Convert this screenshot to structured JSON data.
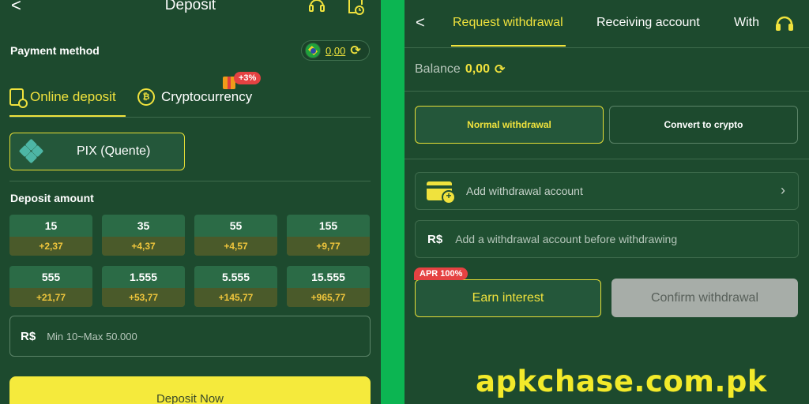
{
  "deposit": {
    "title": "Deposit",
    "back_glyph": "<",
    "support_icon": "headset-icon",
    "history_icon": "document-clock-icon",
    "payment_method_label": "Payment method",
    "balance": "0,00",
    "tabs": [
      {
        "label": "Online deposit",
        "icon": "phone-icon",
        "active": true
      },
      {
        "label": "Cryptocurrency",
        "icon": "coin-icon",
        "active": false,
        "badge": "+3%"
      }
    ],
    "method": {
      "label": "PIX (Quente)",
      "icon": "pix-logo"
    },
    "amount_label": "Deposit amount",
    "amounts": [
      {
        "value": "15",
        "bonus": "+2,37"
      },
      {
        "value": "35",
        "bonus": "+4,37"
      },
      {
        "value": "55",
        "bonus": "+4,57"
      },
      {
        "value": "155",
        "bonus": "+9,77"
      },
      {
        "value": "555",
        "bonus": "+21,77"
      },
      {
        "value": "1.555",
        "bonus": "+53,77"
      },
      {
        "value": "5.555",
        "bonus": "+145,77"
      },
      {
        "value": "15.555",
        "bonus": "+965,77"
      }
    ],
    "currency": "R$",
    "amount_placeholder": "Min 10~Max 50.000",
    "submit_label": "Deposit Now"
  },
  "withdraw": {
    "back_glyph": "<",
    "tabs": [
      {
        "label": "Request withdrawal",
        "active": true
      },
      {
        "label": "Receiving account",
        "active": false
      },
      {
        "label": "With",
        "active": false
      }
    ],
    "balance_label": "Balance",
    "balance_value": "0,00",
    "types": [
      {
        "label": "Normal withdrawal",
        "selected": true
      },
      {
        "label": "Convert to crypto",
        "selected": false
      }
    ],
    "add_account_label": "Add withdrawal account",
    "currency": "R$",
    "input_placeholder": "Add a withdrawal account before withdrawing",
    "apr_badge": "APR 100%",
    "earn_label": "Earn interest",
    "confirm_label": "Confirm withdrawal"
  },
  "watermark": "apkchase.com.pk",
  "colors": {
    "panel_bg": "#1d4a2e",
    "accent_yellow": "#f0e23d",
    "divider_green": "#0cb552",
    "bonus_red": "#e54242",
    "disabled_gray": "#a7ada8"
  }
}
